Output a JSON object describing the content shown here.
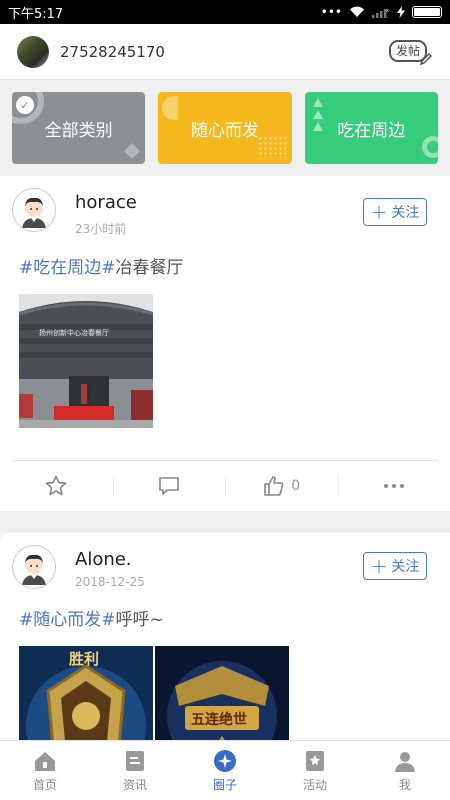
{
  "status_bar": {
    "time": "下午5:17",
    "dots": "•••"
  },
  "header": {
    "user_id": "27528245170",
    "post_label": "发帖"
  },
  "categories": [
    {
      "label": "全部类别",
      "color": "#8e8f93"
    },
    {
      "label": "随心而发",
      "color": "#f5b91f"
    },
    {
      "label": "吃在周边",
      "color": "#35cc7b"
    }
  ],
  "posts": [
    {
      "username": "horace",
      "time": "23小时前",
      "follow_label": "关注",
      "tags": [
        "#吃在周边#"
      ],
      "text": "冶春餐厅",
      "like_count": "0"
    },
    {
      "username": "Alone.",
      "time": "2018-12-25",
      "follow_label": "关注",
      "tags": [
        "#随心而发#"
      ],
      "text": "呼呼~"
    }
  ],
  "photo_signs": {
    "sign1": "扬州创新中心冶春餐厅",
    "sign2": "胜利",
    "sign3": "五连绝世"
  },
  "tabs": [
    {
      "label": "首页",
      "icon": "home-icon"
    },
    {
      "label": "资讯",
      "icon": "news-icon"
    },
    {
      "label": "圈子",
      "icon": "circle-icon",
      "active": true
    },
    {
      "label": "活动",
      "icon": "activity-icon"
    },
    {
      "label": "我",
      "icon": "profile-icon"
    }
  ],
  "colors": {
    "accent": "#3b6cc4",
    "tag": "#4a78c8",
    "gray_card": "#8e8f93",
    "yellow_card": "#f5b91f",
    "green_card": "#35cc7b"
  }
}
